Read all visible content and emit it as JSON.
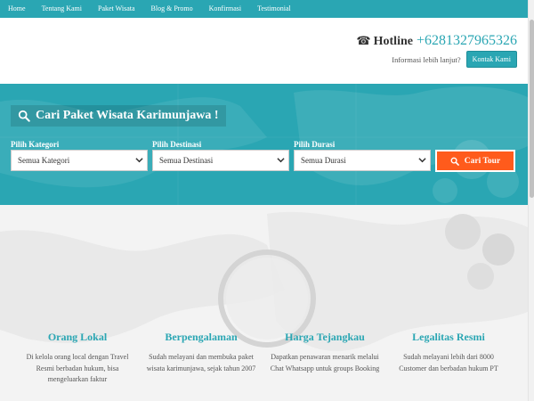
{
  "nav": {
    "items": [
      {
        "label": "Home"
      },
      {
        "label": "Tentang Kami"
      },
      {
        "label": "Paket Wisata"
      },
      {
        "label": "Blog & Promo"
      },
      {
        "label": "Konfirmasi"
      },
      {
        "label": "Testimonial"
      }
    ]
  },
  "header": {
    "hotline_label": "Hotline",
    "hotline_number": "+6281327965326",
    "info_text": "Informasi lebih lanjut?",
    "contact_button": "Kontak Kami"
  },
  "search": {
    "title": "Cari Paket Wisata Karimunjawa !",
    "category_label": "Pilih Kategori",
    "category_value": "Semua Kategori",
    "destination_label": "Pilih Destinasi",
    "destination_value": "Semua Destinasi",
    "duration_label": "Pilih Durasi",
    "duration_value": "Semua Durasi",
    "button_label": "Cari Tour"
  },
  "features": [
    {
      "title": "Orang Lokal",
      "desc": "Di kelola orang local dengan Travel Resmi berbadan hukum, bisa mengeluarkan faktur"
    },
    {
      "title": "Berpengalaman",
      "desc": "Sudah melayani dan membuka paket wisata karimunjawa, sejak tahun 2007"
    },
    {
      "title": "Harga Tejangkau",
      "desc": "Dapatkan penawaran menarik melalui Chat Whatsapp untuk groups Booking"
    },
    {
      "title": "Legalitas Resmi",
      "desc": "Sudah melayani lebih dari 8000 Customer dan berbadan hukum PT"
    }
  ],
  "colors": {
    "accent": "#2aa6b3",
    "button": "#ff5b1c"
  },
  "icons": {
    "phone": "phone-icon",
    "search": "search-icon"
  }
}
